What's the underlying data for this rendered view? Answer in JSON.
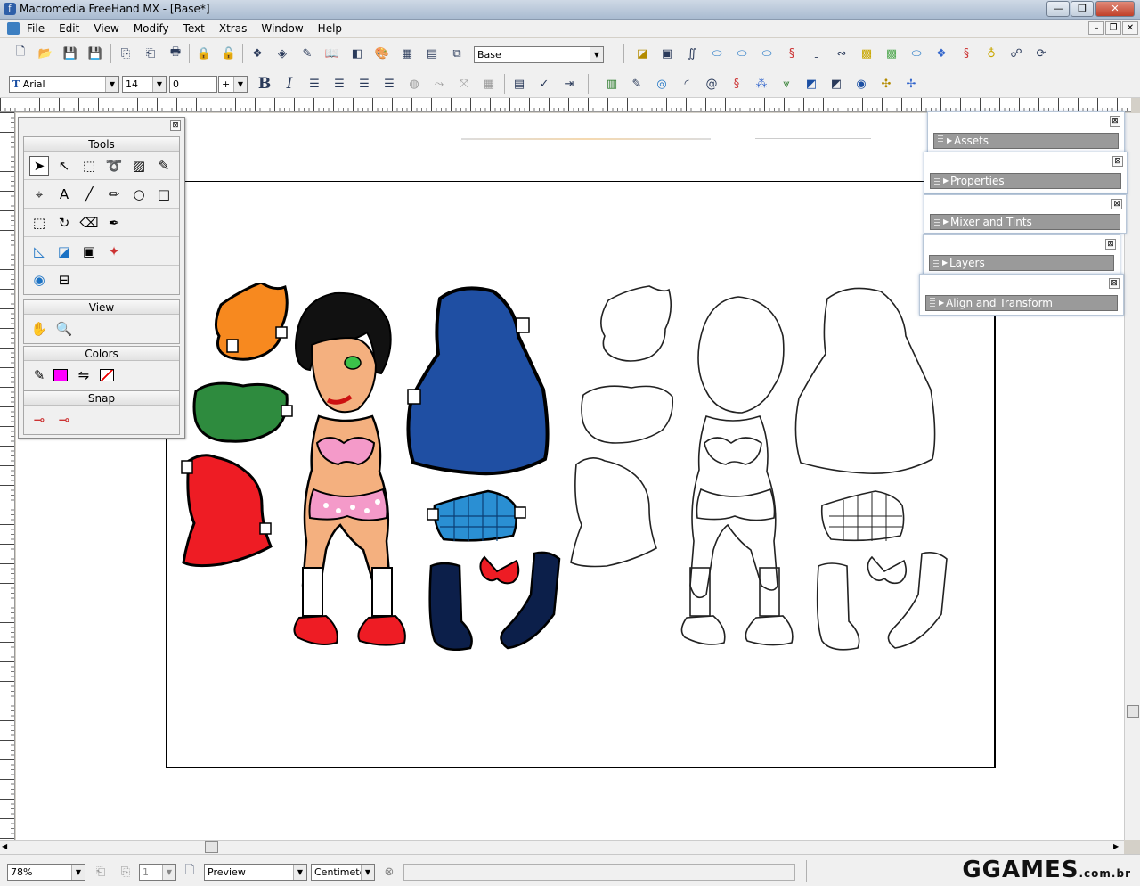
{
  "window": {
    "title": "Macromedia FreeHand MX - [Base*]",
    "minimize": "—",
    "maximize": "❐",
    "close": "✕"
  },
  "menu": [
    "File",
    "Edit",
    "View",
    "Modify",
    "Text",
    "Xtras",
    "Window",
    "Help"
  ],
  "toolbar_main": {
    "style_select": "Base"
  },
  "toolbar_text": {
    "font": "Arial",
    "size": "14",
    "leading": "0",
    "leading_mode": "+",
    "bold": "B",
    "italic": "I"
  },
  "tools_panel": {
    "title": "Tools",
    "view_title": "View",
    "colors_title": "Colors",
    "snap_title": "Snap",
    "fill_color": "#ff00ff"
  },
  "panels": {
    "assets": "Assets",
    "properties": "Properties",
    "mixer": "Mixer and Tints",
    "layers": "Layers",
    "align": "Align and Transform"
  },
  "statusbar": {
    "zoom": "78%",
    "page": "1",
    "view_mode": "Preview",
    "units": "Centimeters"
  },
  "watermark": {
    "main": "GGAMES",
    "suffix": ".com.br"
  },
  "colors": {
    "orange": "#f7891f",
    "green": "#2e8b3e",
    "red": "#ee1c24",
    "blue": "#1f4fa3",
    "pink": "#f49ac9",
    "skin": "#f4b07f"
  }
}
